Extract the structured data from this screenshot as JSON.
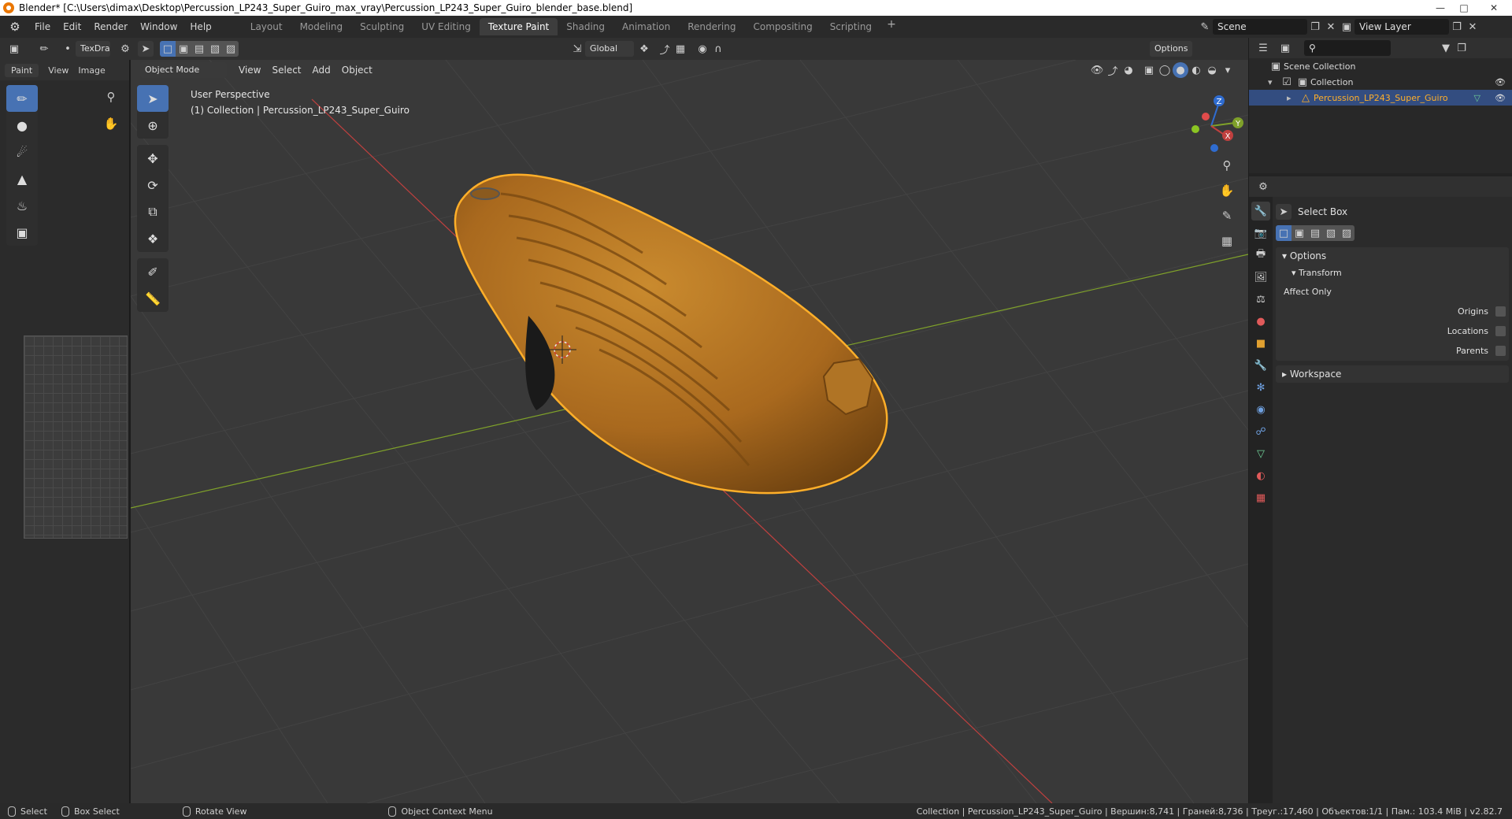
{
  "window": {
    "title": "Blender* [C:\\Users\\dimax\\Desktop\\Percussion_LP243_Super_Guiro_max_vray\\Percussion_LP243_Super_Guiro_blender_base.blend]"
  },
  "menu": [
    "File",
    "Edit",
    "Render",
    "Window",
    "Help"
  ],
  "workspaces": [
    "Layout",
    "Modeling",
    "Sculpting",
    "UV Editing",
    "Texture Paint",
    "Shading",
    "Animation",
    "Rendering",
    "Compositing",
    "Scripting"
  ],
  "active_workspace": "Texture Paint",
  "scene": {
    "name": "Scene",
    "view_layer": "View Layer"
  },
  "tool_header": {
    "brush": "TexDra",
    "transform_orientation": "Global",
    "options": "Options"
  },
  "paint_editor": {
    "mode": "Paint",
    "view": "View",
    "image": "Image"
  },
  "viewport": {
    "mode": "Object Mode",
    "menus": [
      "View",
      "Select",
      "Add",
      "Object"
    ],
    "perspective": "User Perspective",
    "collection_info": "(1) Collection | Percussion_LP243_Super_Guiro",
    "gizmo": {
      "z": "Z",
      "y": "Y",
      "x": "X"
    }
  },
  "outliner": {
    "scene_collection": "Scene Collection",
    "collection": "Collection",
    "object": "Percussion_LP243_Super_Guiro"
  },
  "properties": {
    "tool_name": "Select Box",
    "options": "Options",
    "transform": "Transform",
    "affect_only": "Affect Only",
    "origins": "Origins",
    "locations": "Locations",
    "parents": "Parents",
    "workspace": "Workspace"
  },
  "statusbar": {
    "select": "Select",
    "box_select": "Box Select",
    "rotate_view": "Rotate View",
    "context_menu": "Object Context Menu",
    "stats": "Collection | Percussion_LP243_Super_Guiro | Вершин:8,741 | Граней:8,736 | Треуг.:17,460 | Объектов:1/1 | Пам.: 103.4 MiB | v2.82.7"
  },
  "colors": {
    "accent": "#4772b3",
    "selection_outline": "#ffaf29",
    "object_base": "#b8751f",
    "x_axis": "#c0403f",
    "y_axis": "#7fa12a"
  }
}
